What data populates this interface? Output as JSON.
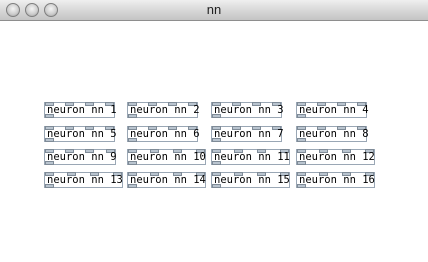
{
  "window": {
    "title": "nn"
  },
  "objects": [
    {
      "label": "neuron nn 1"
    },
    {
      "label": "neuron nn 2"
    },
    {
      "label": "neuron nn 3"
    },
    {
      "label": "neuron nn 4"
    },
    {
      "label": "neuron nn 5"
    },
    {
      "label": "neuron nn 6"
    },
    {
      "label": "neuron nn 7"
    },
    {
      "label": "neuron nn 8"
    },
    {
      "label": "neuron nn 9"
    },
    {
      "label": "neuron nn 10"
    },
    {
      "label": "neuron nn 11"
    },
    {
      "label": "neuron nn 12"
    },
    {
      "label": "neuron nn 13"
    },
    {
      "label": "neuron nn 14"
    },
    {
      "label": "neuron nn 15"
    },
    {
      "label": "neuron nn 16"
    }
  ]
}
